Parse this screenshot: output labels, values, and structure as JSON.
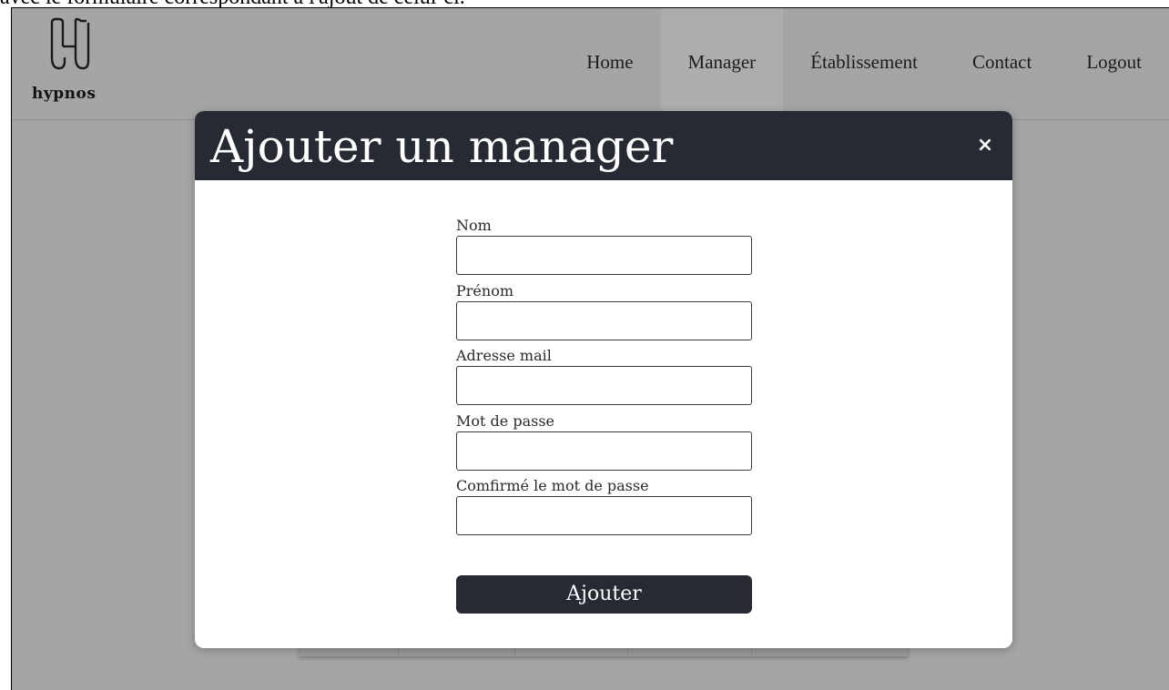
{
  "caption": "avec le formulaire correspondant à l'ajout de celui-ci.",
  "logo": {
    "text": "hypnos",
    "icon": "hypnos-h-logo"
  },
  "nav": {
    "items": [
      {
        "label": "Home",
        "active": false
      },
      {
        "label": "Manager",
        "active": true
      },
      {
        "label": "Établissement",
        "active": false
      },
      {
        "label": "Contact",
        "active": false
      },
      {
        "label": "Logout",
        "active": false
      }
    ]
  },
  "modal": {
    "title": "Ajouter un manager",
    "close_icon": "close-icon",
    "close_glyph": "×",
    "fields": [
      {
        "label": "Nom",
        "value": ""
      },
      {
        "label": "Prénom",
        "value": ""
      },
      {
        "label": "Adresse mail",
        "value": ""
      },
      {
        "label": "Mot de passe",
        "value": ""
      },
      {
        "label": "Comfirmé le mot de passe",
        "value": ""
      }
    ],
    "submit_label": "Ajouter"
  },
  "colors": {
    "overlay": "#a5a5a5",
    "modal_header": "#262a33",
    "button": "#262a33",
    "active_nav": "#adadad"
  }
}
